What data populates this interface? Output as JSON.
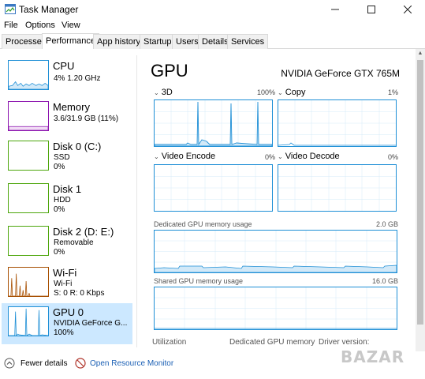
{
  "window": {
    "title": "Task Manager",
    "icon": "task-manager-icon"
  },
  "controls": {
    "minimize": "—",
    "maximize": "☐",
    "close": "✕"
  },
  "menu": {
    "file": "File",
    "options": "Options",
    "view": "View"
  },
  "tabs": [
    "Processes",
    "Performance",
    "App history",
    "Startup",
    "Users",
    "Details",
    "Services"
  ],
  "active_tab": "Performance",
  "sidebar": {
    "items": [
      {
        "title": "CPU",
        "sub1": "4% 1.20 GHz",
        "sub2": "",
        "sub3": "",
        "color": "#1e8fd6"
      },
      {
        "title": "Memory",
        "sub1": "3.6/31.9 GB (11%)",
        "sub2": "",
        "sub3": "",
        "color": "#8b12ae"
      },
      {
        "title": "Disk 0 (C:)",
        "sub1": "SSD",
        "sub2": "0%",
        "sub3": "",
        "color": "#4da60c"
      },
      {
        "title": "Disk 1",
        "sub1": "HDD",
        "sub2": "0%",
        "sub3": "",
        "color": "#4da60c"
      },
      {
        "title": "Disk 2 (D: E:)",
        "sub1": "Removable",
        "sub2": "0%",
        "sub3": "",
        "color": "#4da60c"
      },
      {
        "title": "Wi-Fi",
        "sub1": "Wi-Fi",
        "sub2": "S: 0 R: 0 Kbps",
        "sub3": "",
        "color": "#a74f01"
      },
      {
        "title": "GPU 0",
        "sub1": "NVIDIA GeForce G...",
        "sub2": "100%",
        "sub3": "",
        "color": "#1e8fd6"
      }
    ]
  },
  "main": {
    "title": "GPU",
    "model": "NVIDIA GeForce GTX 765M",
    "graphs": {
      "3d": {
        "label": "3D",
        "pct": "100%"
      },
      "copy": {
        "label": "Copy",
        "pct": "1%"
      },
      "video_encode": {
        "label": "Video Encode",
        "pct": "0%"
      },
      "video_decode": {
        "label": "Video Decode",
        "pct": "0%"
      }
    },
    "dedicated": {
      "label": "Dedicated GPU memory usage",
      "max": "2.0 GB"
    },
    "shared": {
      "label": "Shared GPU memory usage",
      "max": "16.0 GB"
    },
    "stats": {
      "utilization": "Utilization",
      "dedicated_memory": "Dedicated GPU memory",
      "driver_version": "Driver version:"
    }
  },
  "footer": {
    "fewer_details": "Fewer details",
    "open_resource_monitor": "Open Resource Monitor"
  },
  "watermark": {
    "text": "BAZAR"
  },
  "accent": "#1e8fd6"
}
